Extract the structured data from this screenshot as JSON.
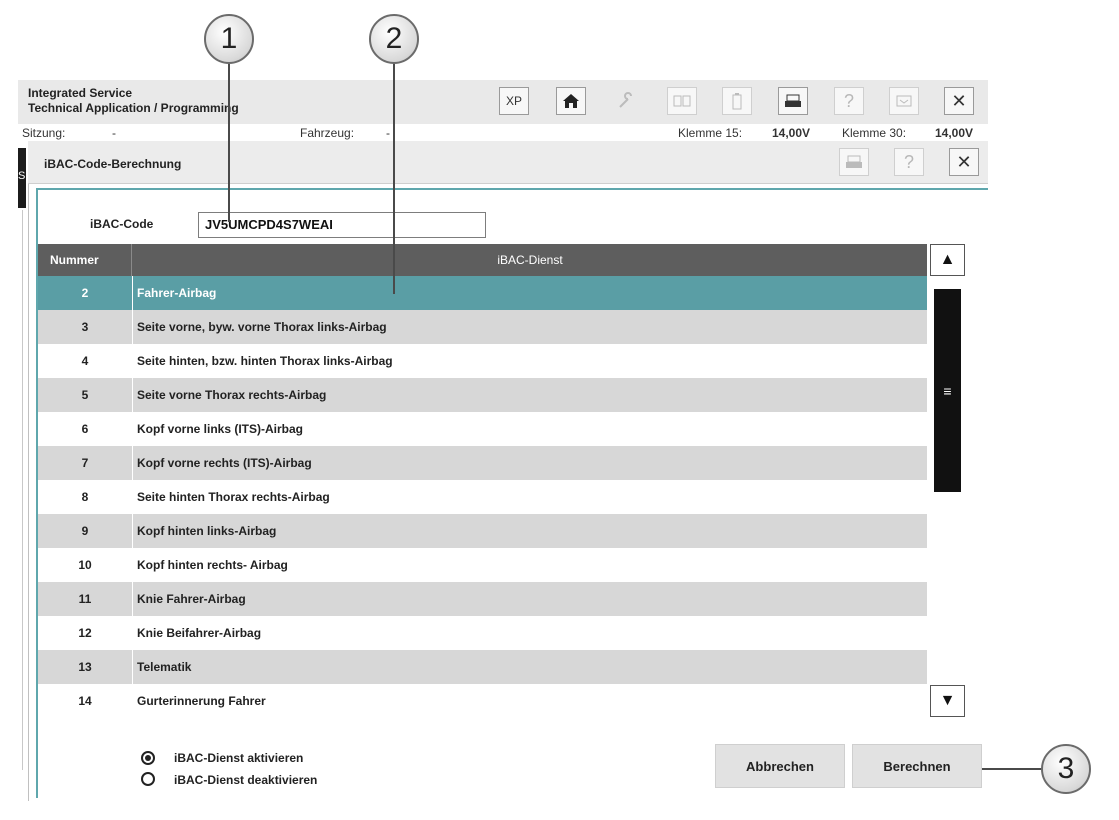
{
  "callouts": {
    "c1": "1",
    "c2": "2",
    "c3": "3"
  },
  "app": {
    "title_line1": "Integrated Service",
    "title_line2": "Technical Application / Programming",
    "toolbar": {
      "xp": "XP",
      "help": "?",
      "close": "✕"
    },
    "status": {
      "session_label": "Sitzung:",
      "session_value": "-",
      "vehicle_label": "Fahrzeug:",
      "vehicle_value": "-",
      "k15_label": "Klemme 15:",
      "k15_value": "14,00V",
      "k30_label": "Klemme 30:",
      "k30_value": "14,00V"
    },
    "left_tab": "S"
  },
  "dialog": {
    "title": "iBAC-Code-Berechnung",
    "help": "?",
    "close": "✕",
    "code_label": "iBAC-Code",
    "code_value": "JV5UMCPD4S7WEAI",
    "table": {
      "col_number": "Nummer",
      "col_service": "iBAC-Dienst",
      "rows": [
        {
          "num": "2",
          "service": "Fahrer-Airbag"
        },
        {
          "num": "3",
          "service": "Seite vorne, byw. vorne Thorax links-Airbag"
        },
        {
          "num": "4",
          "service": "Seite hinten, bzw. hinten Thorax links-Airbag"
        },
        {
          "num": "5",
          "service": "Seite vorne Thorax rechts-Airbag"
        },
        {
          "num": "6",
          "service": "Kopf vorne links (ITS)-Airbag"
        },
        {
          "num": "7",
          "service": "Kopf vorne rechts (ITS)-Airbag"
        },
        {
          "num": "8",
          "service": "Seite hinten Thorax rechts-Airbag"
        },
        {
          "num": "9",
          "service": "Kopf hinten links-Airbag"
        },
        {
          "num": "10",
          "service": "Kopf hinten rechts- Airbag"
        },
        {
          "num": "11",
          "service": "Knie Fahrer-Airbag"
        },
        {
          "num": "12",
          "service": "Knie Beifahrer-Airbag"
        },
        {
          "num": "13",
          "service": "Telematik"
        },
        {
          "num": "14",
          "service": "Gurterinnerung Fahrer"
        }
      ],
      "selected_row": 0
    },
    "scrollbar": {
      "up": "▲",
      "down": "▼",
      "grip": "≡"
    },
    "radio": {
      "activate": "iBAC-Dienst aktivieren",
      "deactivate": "iBAC-Dienst deaktivieren",
      "selected": "activate"
    },
    "buttons": {
      "cancel": "Abbrechen",
      "calculate": "Berechnen"
    }
  }
}
